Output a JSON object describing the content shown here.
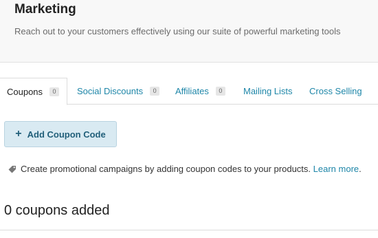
{
  "header": {
    "title": "Marketing",
    "subtitle": "Reach out to your customers effectively using our suite of powerful marketing tools"
  },
  "tabs": [
    {
      "label": "Coupons",
      "badge": "0",
      "active": true
    },
    {
      "label": "Social Discounts",
      "badge": "0",
      "active": false
    },
    {
      "label": "Affiliates",
      "badge": "0",
      "active": false
    },
    {
      "label": "Mailing Lists",
      "active": false
    },
    {
      "label": "Cross Selling",
      "active": false
    }
  ],
  "actions": {
    "add_coupon_label": "Add Coupon Code",
    "add_icon": "plus-icon"
  },
  "info": {
    "icon": "tag-icon",
    "text": "Create promotional campaigns by adding coupon codes to your products.",
    "link_text": "Learn more",
    "trailing": "."
  },
  "coupons": {
    "count_text": "0 coupons added"
  },
  "colors": {
    "link": "#1e86a8",
    "button_bg": "#d9eaf2",
    "button_text": "#215f7a"
  }
}
